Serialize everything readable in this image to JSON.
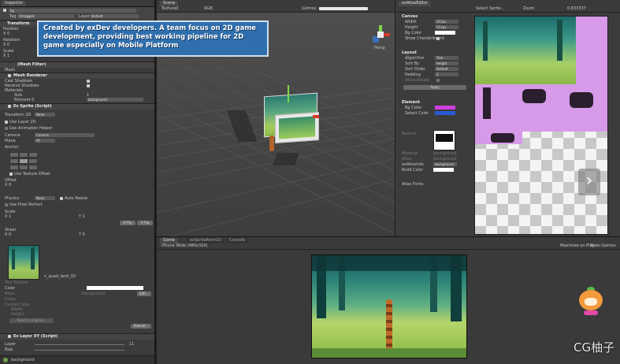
{
  "inspector": {
    "tab_label": "Inspector",
    "tag_label": "Tag",
    "tag_value": "Untagged",
    "layer_label": "Layer",
    "layer_value": "Default",
    "transform_title": "Transform",
    "position_label": "Position",
    "rotation_label": "Rotation",
    "scale_label": "Scale",
    "x_label": "X",
    "y_label": "Y",
    "z_label": "Z",
    "zero": "0",
    "one": "1",
    "mesh_filter_title": "(Mesh Filter)",
    "mesh_label": "Mesh",
    "mesh_renderer_title": "Mesh Renderer",
    "cast_shadows_label": "Cast Shadows",
    "receive_shadows_label": "Receive Shadows",
    "materials_label": "Materials",
    "size_label": "Size",
    "element0_label": "Element 0",
    "material_value": "background",
    "ex_sprite_title": "Ex Sprite (Script)",
    "transform2d_label": "Transform 2D",
    "transform2d_value": "None",
    "use_layer2d_label": "Use Layer 2D",
    "use_anim_helper_label": "Use Animation Helper",
    "camera_label": "Camera",
    "camera_value": "Camera",
    "plane_label": "Plane",
    "plane_value": "XY",
    "anchor_label": "Anchor",
    "use_texture_offset_label": "Use Texture Offset",
    "offset_label": "Offset",
    "physics_label": "Physics",
    "physics_value": "None",
    "auto_resize_label": "Auto Resize",
    "use_pixel_perfect_label": "Use Pixel Perfect",
    "flip_h_label": "H Flip",
    "flip_v_label": "V Flip",
    "shear_label": "Shear",
    "texture_name": "v_quad_land_02",
    "tint_texture_label": "Tint Texture",
    "color_label": "Color",
    "atlas_label": "Atlas",
    "atlas_value": "background",
    "edit_label": "Edit...",
    "index_label": "Index",
    "custom_size_label": "Custom Size",
    "width_label": "Width",
    "height_label": "Height",
    "reset_original_label": "Reset to original...",
    "rebuild_label": "Rebuild...",
    "ex_layer_title": "Ex Layer XY (Script)",
    "layer_field_label": "Layer",
    "layer_field_value": "11",
    "bias_label": "Bias",
    "footer_label": "background"
  },
  "scene": {
    "tab_label": "Scene",
    "mode_value": "Textured",
    "rgb_value": "RGB",
    "gizmos_label": "Gizmos",
    "search_placeholder": "All",
    "persp_label": "Persp",
    "caption": "Created by exDev developers. A team focus on 2D game development, providing best working pipeline for 2D game especially on Mobile Platform"
  },
  "atlas_editor": {
    "tab_label": "exAtlasEditor",
    "select_sprite_label": "Select Sprite...",
    "zoom_label": "Zoom",
    "zoom_value": "0.833337",
    "canvas_section": "Canvas",
    "width_label": "Width",
    "width_value": "512px",
    "height_label": "Height",
    "height_value": "512px",
    "bg_color_label": "Bg Color",
    "show_checkerboard_label": "Show Checkerboard",
    "layout_section": "Layout",
    "algorithm_label": "Algorithm",
    "algorithm_value": "Tree",
    "sort_by_label": "Sort By",
    "sort_by_value": "Height",
    "sort_order_label": "Sort Order",
    "sort_order_value": "Default",
    "padding_label": "Padding",
    "padding_value": "2",
    "allow_rotate_label": "Allow Rotate",
    "apply_label": "Apply",
    "element_section": "Element",
    "elem_bg_color_label": "Bg Color",
    "select_color_label": "Select Color",
    "texture_label": "Texture",
    "material_label": "Material",
    "material_value": "background",
    "atlas_label": "Atlas",
    "atlas_value": "background",
    "atlasinfo_label": "exAtlasInfo",
    "atlasinfo_value": "background",
    "build_color_label": "Build Color",
    "atlas_fonts_label": "Atlas Fonts"
  },
  "game": {
    "tab_game": "Game",
    "tab_anim": "exSpriteAnimCli",
    "tab_console": "Console",
    "resolution_value": "iPhone Wide (480x320)",
    "maximize_label": "Maximize on Play",
    "stats_label": "Stats",
    "gizmos_label": "Gizmos"
  },
  "watermark": {
    "text": "CG柚子"
  },
  "colors": {
    "caption_bg": "#2f6fae",
    "sprite_magenta": "#d79ae8",
    "accent_blue": "#3b6fb6"
  }
}
